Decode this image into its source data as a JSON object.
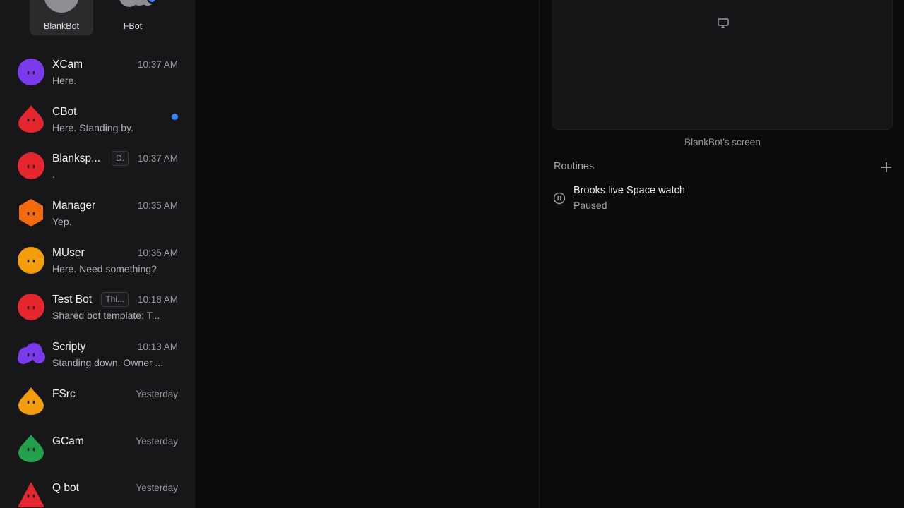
{
  "top_bots": [
    {
      "label": "BlankBot",
      "selected": true
    },
    {
      "label": "FBot",
      "selected": false,
      "badge": true
    }
  ],
  "chats": [
    {
      "name": "XCam",
      "preview": "Here.",
      "time": "10:37 AM",
      "tag": "",
      "unread": false,
      "color": "#7c3aed",
      "shape": "circle"
    },
    {
      "name": "CBot",
      "preview": "Here. Standing by.",
      "time": "",
      "tag": "",
      "unread": true,
      "color": "#e5262f",
      "shape": "drop"
    },
    {
      "name": "Blanksp...",
      "preview": ".",
      "time": "10:37 AM",
      "tag": "D.",
      "unread": false,
      "color": "#e5262f",
      "shape": "circle"
    },
    {
      "name": "Manager",
      "preview": "Yep.",
      "time": "10:35 AM",
      "tag": "",
      "unread": false,
      "color": "#f26b0f",
      "shape": "hexagon"
    },
    {
      "name": "MUser",
      "preview": "Here. Need something?",
      "time": "10:35 AM",
      "tag": "",
      "unread": false,
      "color": "#f59e0b",
      "shape": "circle"
    },
    {
      "name": "Test Bot",
      "preview": "Shared bot template: T...",
      "time": "10:18 AM",
      "tag": "Thi...",
      "unread": false,
      "color": "#e5262f",
      "shape": "circle"
    },
    {
      "name": "Scripty",
      "preview": "Standing down. Owner ...",
      "time": "10:13 AM",
      "tag": "",
      "unread": false,
      "color": "#7c3aed",
      "shape": "cloud"
    },
    {
      "name": "FSrc",
      "preview": "",
      "time": "Yesterday",
      "tag": "",
      "unread": false,
      "color": "#f59e0b",
      "shape": "drop"
    },
    {
      "name": "GCam",
      "preview": "",
      "time": "Yesterday",
      "tag": "",
      "unread": false,
      "color": "#22a04b",
      "shape": "drop"
    },
    {
      "name": "Q bot",
      "preview": "",
      "time": "Yesterday",
      "tag": "",
      "unread": false,
      "color": "#e5262f",
      "shape": "triangle"
    }
  ],
  "right_panel": {
    "screen_caption": "BlankBot's screen",
    "routines_title": "Routines",
    "routines": [
      {
        "name": "Brooks live Space watch",
        "status": "Paused"
      }
    ]
  },
  "icons": {
    "monitor": "monitor-icon",
    "add": "plus-icon",
    "pause": "pause-circle-icon"
  },
  "colors": {
    "accent_blue": "#3b82f6",
    "sidebar_bg": "#171719",
    "main_bg": "#0b0b0c"
  }
}
